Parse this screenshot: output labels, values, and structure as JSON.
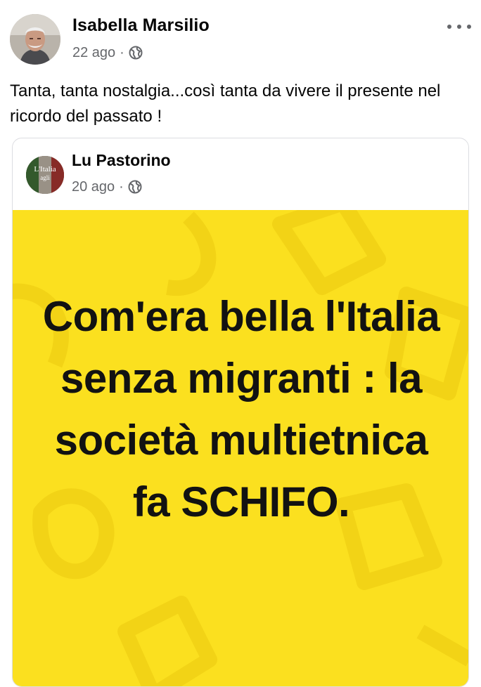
{
  "post": {
    "author": "Isabella Marsilio",
    "time": "22 ago",
    "separator": "·",
    "privacy_icon": "globe-icon",
    "more_icon": "more-options-icon",
    "text": "Tanta, tanta nostalgia...così tanta da vivere il presente nel ricordo del passato !"
  },
  "shared_post": {
    "author": "Lu Pastorino",
    "time": "20 ago",
    "separator": "·",
    "privacy_icon": "globe-icon",
    "avatar_text": "L'Italia agli Italiani",
    "image_text": "Com'era bella l'Italia senza migranti : la società multietnica fa SCHIFO."
  },
  "colors": {
    "poster_background": "#fbe01f",
    "poster_text": "#121212",
    "meta_text": "#65676b"
  }
}
